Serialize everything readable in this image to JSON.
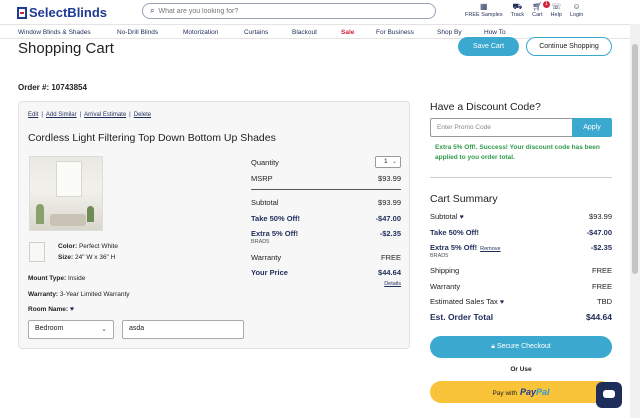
{
  "header": {
    "logo": "SelectBlinds",
    "search_placeholder": "What are you looking for?",
    "icons": [
      {
        "label": "FREE Samples",
        "icon": "grid-icon"
      },
      {
        "label": "Track",
        "icon": "truck-icon"
      },
      {
        "label": "Cart",
        "icon": "cart-icon"
      },
      {
        "label": "Help",
        "icon": "help-icon"
      },
      {
        "label": "Login",
        "icon": "user-icon"
      }
    ],
    "cart_count": "1"
  },
  "nav": [
    "Window Blinds & Shades",
    "No-Drill Blinds",
    "Motorization",
    "Curtains",
    "Blackout",
    "Sale",
    "For Business",
    "Shop By",
    "How To"
  ],
  "page": {
    "title": "Shopping Cart",
    "save_cart": "Save Cart",
    "continue_shopping": "Continue Shopping",
    "order": "Order #: 10743854"
  },
  "item": {
    "links": [
      "Edit",
      "Add Similar",
      "Arrival Estimate",
      "Delete"
    ],
    "title": "Cordless Light Filtering Top Down Bottom Up Shades",
    "color_label": "Color:",
    "color_value": "Perfect White",
    "size_label": "Size:",
    "size_value": "24\" W x 36\" H",
    "mount_label": "Mount Type:",
    "mount_value": "Inside",
    "warranty_label": "Warranty:",
    "warranty_value": "3-Year Limited Warranty",
    "room_label": "Room Name:",
    "room_select": "Bedroom",
    "room_input": "asda",
    "quantity_label": "Quantity",
    "quantity_value": "1",
    "msrp_label": "MSRP",
    "msrp_value": "$93.99",
    "subtotal_label": "Subtotal",
    "subtotal_value": "$93.99",
    "off50_label": "Take 50% Off!",
    "off50_value": "-$47.00",
    "extra5_label": "Extra 5% Off!",
    "extra5_code": "BRAD5",
    "extra5_value": "-$2.35",
    "warranty_row_label": "Warranty",
    "warranty_row_value": "FREE",
    "your_price_label": "Your Price",
    "your_price_value": "$44.64",
    "details": "Details"
  },
  "discount": {
    "title": "Have a Discount Code?",
    "placeholder": "Enter Promo Code",
    "apply": "Apply",
    "success": "Extra 5% Off!. Success! Your discount code has been applied to you order total."
  },
  "summary": {
    "title": "Cart Summary",
    "subtotal_label": "Subtotal",
    "subtotal_value": "$93.99",
    "off50_label": "Take 50% Off!",
    "off50_value": "-$47.00",
    "extra5_label": "Extra 5% Off!",
    "remove": "Remove",
    "extra5_code": "BRAD5",
    "extra5_value": "-$2.35",
    "shipping_label": "Shipping",
    "shipping_value": "FREE",
    "warranty_label": "Warranty",
    "warranty_value": "FREE",
    "tax_label": "Estimated Sales Tax",
    "tax_value": "TBD",
    "total_label": "Est. Order Total",
    "total_value": "$44.64",
    "secure_checkout": "Secure Checkout",
    "or_use": "Or Use",
    "paypal_prefix": "Pay with",
    "paypal_brand_a": "Pay",
    "paypal_brand_b": "Pal"
  }
}
